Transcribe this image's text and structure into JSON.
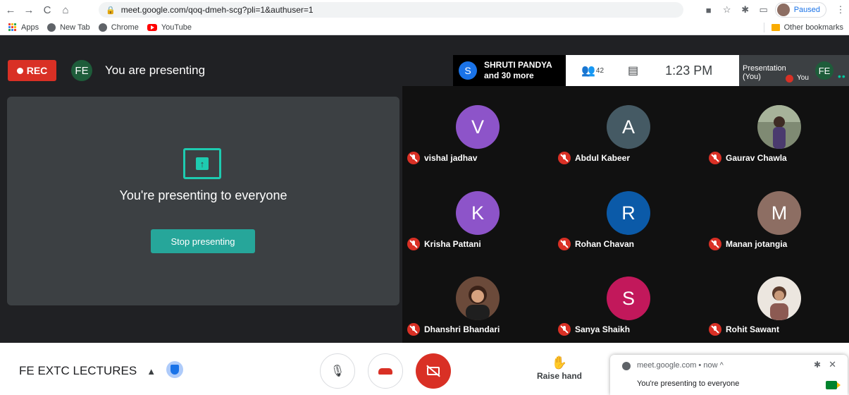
{
  "browser": {
    "url": "meet.google.com/qoq-dmeh-scg?pli=1&authuser=1",
    "profile_status": "Paused",
    "nav_icons": {
      "back": "←",
      "forward": "→",
      "reload": "C",
      "home": "⌂"
    },
    "bookmarks": [
      {
        "label": "Apps",
        "icon": "apps-grid-icon"
      },
      {
        "label": "New Tab",
        "icon": "globe-icon"
      },
      {
        "label": "Chrome",
        "icon": "globe-icon"
      },
      {
        "label": "YouTube",
        "icon": "youtube-icon"
      }
    ],
    "other_bookmarks": "Other bookmarks"
  },
  "meet": {
    "rec_label": "REC",
    "self_initials": "FE",
    "presenting_title": "You are presenting",
    "active_speaker": {
      "initial": "S",
      "name": "SHRUTI PANDYA",
      "more": "and 30 more"
    },
    "participant_count": "42",
    "clock": "1:23 PM",
    "presentation_tile": {
      "label_line1": "Presentation",
      "label_line2": "(You)",
      "you_label": "You",
      "initials": "FE"
    },
    "presenting_message": "You're presenting to everyone",
    "stop_presenting_label": "Stop presenting",
    "participants": [
      {
        "name": "vishal jadhav",
        "initial": "V",
        "color": "#8d54c9",
        "type": "letter"
      },
      {
        "name": "Abdul Kabeer",
        "initial": "A",
        "color": "#455a64",
        "type": "letter"
      },
      {
        "name": "Gaurav Chawla",
        "initial": "",
        "color": "#6d7d6a",
        "type": "photo"
      },
      {
        "name": "Krisha Pattani",
        "initial": "K",
        "color": "#8d54c9",
        "type": "letter"
      },
      {
        "name": "Rohan Chavan",
        "initial": "R",
        "color": "#0b5aa8",
        "type": "letter"
      },
      {
        "name": "Manan jotangia",
        "initial": "M",
        "color": "#8d6e63",
        "type": "letter"
      },
      {
        "name": "Dhanshri Bhandari",
        "initial": "",
        "color": "#5d4037",
        "type": "photo"
      },
      {
        "name": "Sanya Shaikh",
        "initial": "S",
        "color": "#c2185b",
        "type": "letter"
      },
      {
        "name": "Rohit Sawant",
        "initial": "",
        "color": "#e8e0d8",
        "type": "photo"
      }
    ],
    "meeting_name": "FE EXTC LECTURES",
    "raise_hand_label": "Raise hand"
  },
  "notification": {
    "source": "meet.google.com • now ^",
    "body": "You're presenting to everyone"
  }
}
